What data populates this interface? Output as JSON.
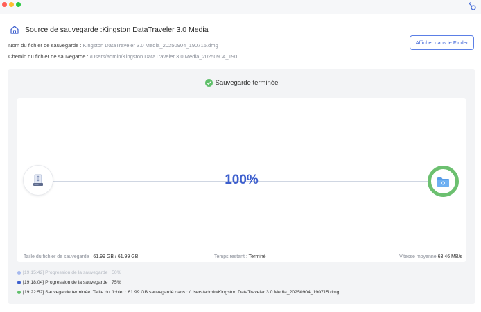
{
  "window": {
    "controls": [
      "close",
      "minimize",
      "maximize"
    ],
    "key_icon": "key-icon"
  },
  "header": {
    "icon": "home-icon",
    "title": "Source de sauvegarde :Kingston DataTraveler 3.0 Media"
  },
  "file_info": {
    "name_label": "Nom du fichier de sauvegarde : ",
    "name_value": "Kingston DataTraveler 3.0 Media_20250904_190715.dmg",
    "path_label": "Chemin du fichier de sauvegarde : ",
    "path_value": "/Users/admin/Kingston DataTraveler 3.0 Media_20250904_190..."
  },
  "finder_button": {
    "label": "Afficher dans le Finder"
  },
  "status": {
    "icon": "check-circle-icon",
    "text": "Sauvegarde terminée"
  },
  "progress": {
    "percent_text": "100%",
    "fraction": 1.0,
    "source_icon": "usb-drive-icon",
    "destination_icon": "folder-icon"
  },
  "stats": {
    "size_label": "Taille du fichier de sauvegarde : ",
    "size_value": "61.99 GB / 61.99 GB",
    "remaining_label": "Temps restant : ",
    "remaining_value": "Terminé",
    "speed_label": "Vitesse moyenne ",
    "speed_value": "63.46 MB/s"
  },
  "logs": [
    {
      "text": "[19:15:42] Progression de la sauvegarde : 50%",
      "color": "#a6b9ee"
    },
    {
      "text": "[19:18:04] Progression de la sauvegarde : 75%",
      "color": "#3d5fce"
    },
    {
      "text": "[19:22:52] Sauvegarde terminée. Taille du fichier : 61.99 GB sauvegardé dans : /Users/admin/Kingston DataTraveler 3.0 Media_20250904_190715.dmg",
      "color": "#5fbf6a"
    }
  ],
  "colors": {
    "accent": "#3d5fce",
    "success": "#6cc070",
    "panel_bg": "#f3f4f6"
  }
}
